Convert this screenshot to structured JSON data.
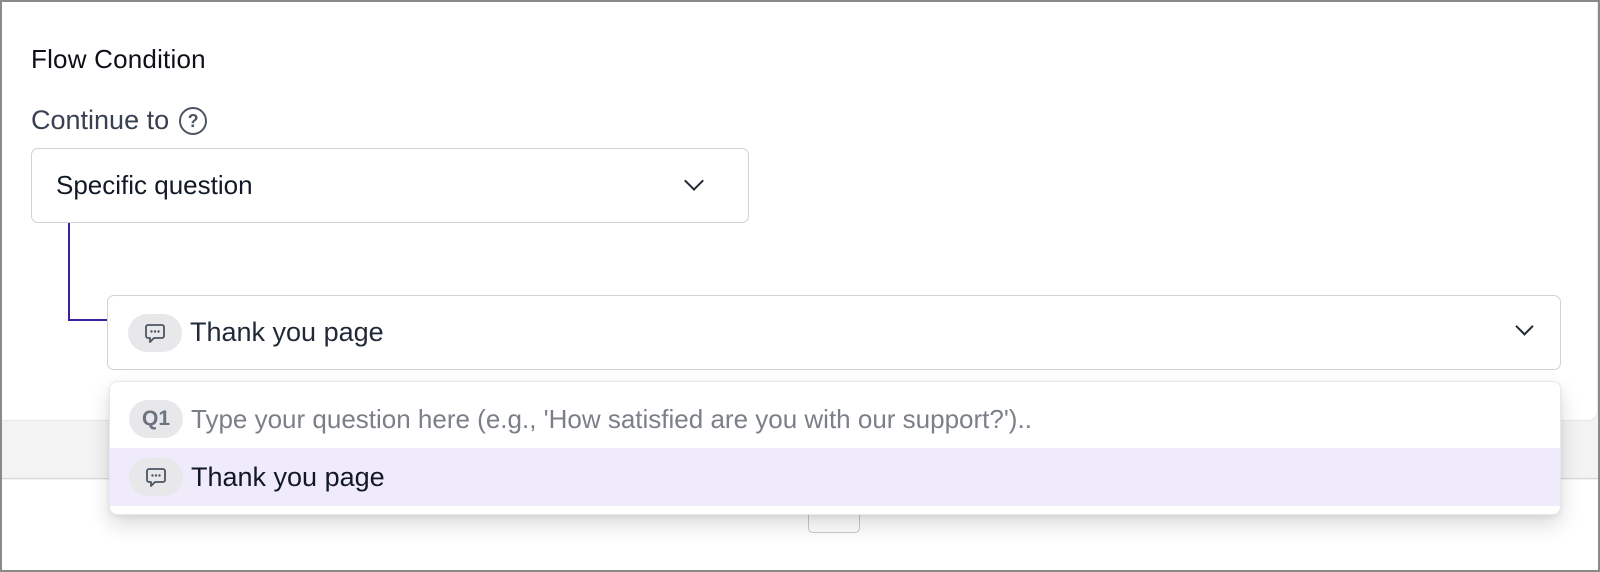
{
  "section": {
    "title": "Flow Condition"
  },
  "continue_to": {
    "label": "Continue to",
    "help_icon": "help-circle-icon",
    "selected": "Specific question"
  },
  "target_select": {
    "icon": "message-bubble-icon",
    "selected": "Thank you page"
  },
  "dropdown": {
    "options": [
      {
        "badge": "Q1",
        "text": "Type your question here (e.g., 'How satisfied are you with our support?')..",
        "highlighted": false
      },
      {
        "icon": "message-bubble-icon",
        "text": "Thank you page",
        "highlighted": true
      }
    ]
  },
  "colors": {
    "connector": "#3b1fa0",
    "highlight": "#efebfb",
    "chip": "#e8e8ea"
  }
}
